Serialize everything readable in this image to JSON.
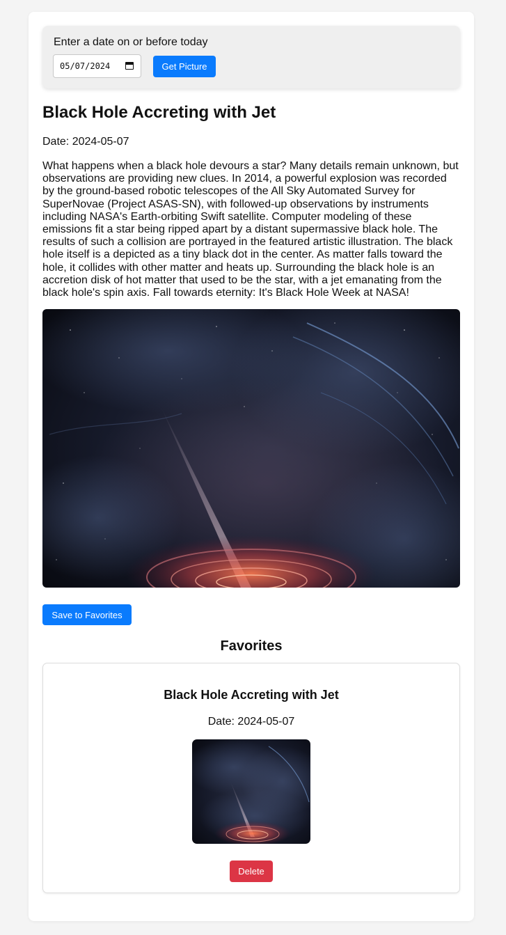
{
  "date_picker": {
    "label": "Enter a date on or before today",
    "value": "05/07/2024",
    "button_label": "Get Picture"
  },
  "apod": {
    "title": "Black Hole Accreting with Jet",
    "date_text": "Date: 2024-05-07",
    "explanation": "What happens when a black hole devours a star? Many details remain unknown, but observations are providing new clues. In 2014, a powerful explosion was recorded by the ground-based robotic telescopes of the All Sky Automated Survey for SuperNovae (Project ASAS-SN), with followed-up observations by instruments including NASA's Earth-orbiting Swift satellite. Computer modeling of these emissions fit a star being ripped apart by a distant supermassive black hole. The results of such a collision are portrayed in the featured artistic illustration. The black hole itself is a depicted as a tiny black dot in the center. As matter falls toward the hole, it collides with other matter and heats up. Surrounding the black hole is an accretion disk of hot matter that used to be the star, with a jet emanating from the black hole's spin axis. Fall towards eternity: It's Black Hole Week at NASA!",
    "save_button_label": "Save to Favorites"
  },
  "favorites": {
    "heading": "Favorites",
    "items": [
      {
        "title": "Black Hole Accreting with Jet",
        "date_text": "Date: 2024-05-07",
        "delete_label": "Delete"
      }
    ]
  },
  "colors": {
    "primary_button": "#0a7bfd",
    "delete_button": "#dc3545",
    "page_background": "#f4f4f4"
  }
}
